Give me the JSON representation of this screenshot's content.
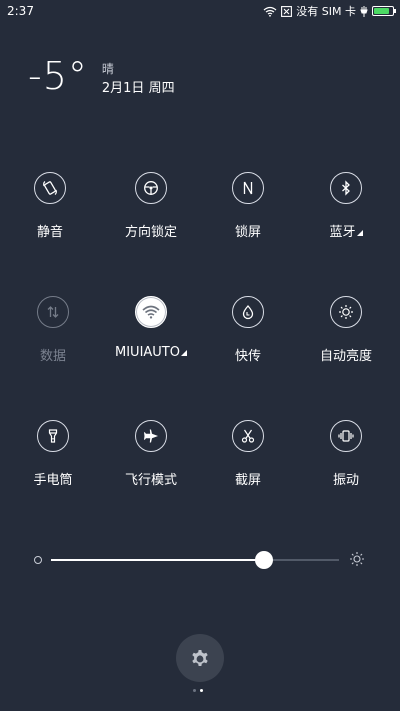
{
  "status_bar": {
    "time": "2:37",
    "sim_text": "没有 SIM 卡",
    "battery_level": 0.85,
    "battery_color": "#4cd964",
    "icons": [
      "wifi-icon",
      "no-sim-icon",
      "charging-icon",
      "battery-icon"
    ]
  },
  "weather": {
    "temperature": "-5°",
    "condition": "晴",
    "date": "2月1日 周四"
  },
  "toggles": [
    {
      "label": "静音",
      "icon": "silent-icon",
      "state": "off"
    },
    {
      "label": "方向锁定",
      "icon": "rotation-lock-icon",
      "state": "off"
    },
    {
      "label": "锁屏",
      "icon": "lock-screen-icon",
      "state": "off"
    },
    {
      "label": "蓝牙",
      "icon": "bluetooth-icon",
      "state": "off",
      "has_menu": true
    },
    {
      "label": "数据",
      "icon": "mobile-data-icon",
      "state": "disabled"
    },
    {
      "label": "MIUIAUTO",
      "icon": "wifi-icon",
      "state": "on",
      "has_menu": true
    },
    {
      "label": "快传",
      "icon": "quick-transfer-icon",
      "state": "off"
    },
    {
      "label": "自动亮度",
      "icon": "auto-brightness-icon",
      "state": "off"
    },
    {
      "label": "手电筒",
      "icon": "flashlight-icon",
      "state": "off"
    },
    {
      "label": "飞行模式",
      "icon": "airplane-icon",
      "state": "off"
    },
    {
      "label": "截屏",
      "icon": "screenshot-icon",
      "state": "off"
    },
    {
      "label": "振动",
      "icon": "vibrate-icon",
      "state": "off"
    }
  ],
  "brightness": {
    "level": 0.74
  },
  "settings": {
    "icon": "gear-icon"
  },
  "pager": {
    "count": 2,
    "active_index": 1
  },
  "colors": {
    "background": "#252c3a",
    "active_toggle": "#ffffff",
    "disabled": "#7b8290"
  }
}
